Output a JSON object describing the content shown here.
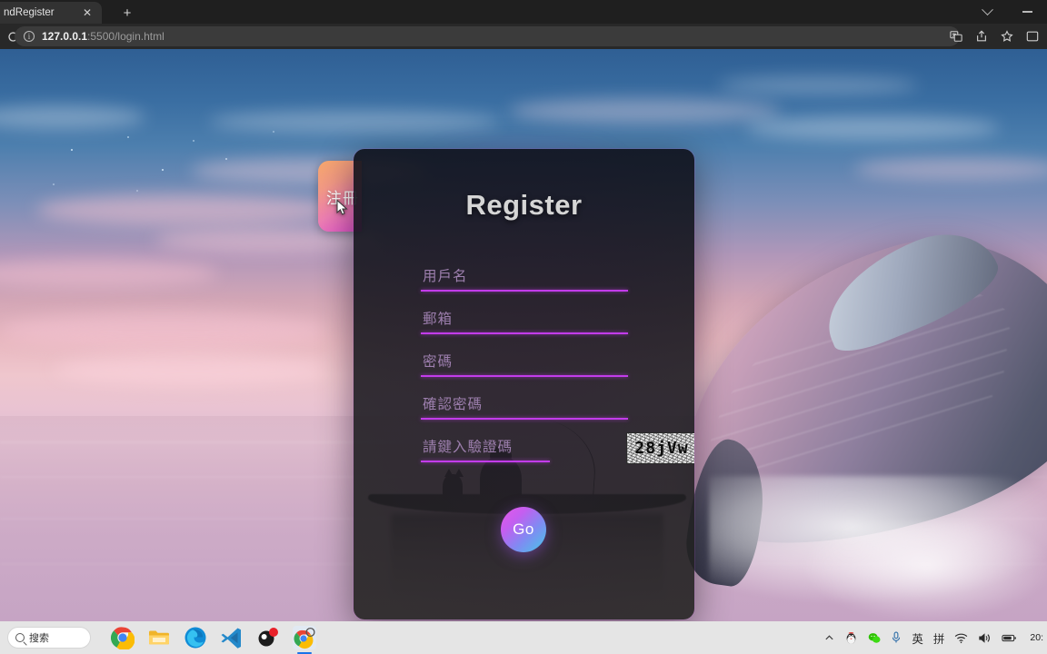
{
  "browser": {
    "tab_title": "ndRegister",
    "tab_close_label": "✕",
    "new_tab_label": "+",
    "url_host": "127.0.0.1",
    "url_path": ":5500/login.html",
    "icons": {
      "reload": "reload-icon",
      "info": "i",
      "translate": "translate-icon",
      "share": "share-icon",
      "bookmark": "star-icon",
      "profile": "profile-icon",
      "chevron_down": "chevron-down-icon",
      "minimize": "minimize-icon"
    }
  },
  "card": {
    "title": "Register",
    "side_tab_label": "注冊",
    "submit_label": "Go",
    "captcha_value": "28jVw",
    "fields": [
      {
        "placeholder": "用戶名",
        "value": "",
        "name": "username"
      },
      {
        "placeholder": "郵箱",
        "value": "",
        "name": "email"
      },
      {
        "placeholder": "密碼",
        "value": "",
        "name": "password"
      },
      {
        "placeholder": "確認密碼",
        "value": "",
        "name": "confirm-password"
      },
      {
        "placeholder": "請鍵入驗證碼",
        "value": "",
        "name": "captcha"
      }
    ],
    "colors": {
      "underline": "#c23cea",
      "placeholder": "#9d7fae",
      "title": "#d5d5d5",
      "tab_gradient_start": "#f7a86b",
      "tab_gradient_end": "#e152cf",
      "go_gradient_start": "#e559e8",
      "go_gradient_end": "#46c8e8"
    }
  },
  "taskbar": {
    "search_placeholder": "搜索",
    "apps": [
      {
        "name": "chrome",
        "label": "Chrome"
      },
      {
        "name": "file-explorer",
        "label": "文件资源管理器"
      },
      {
        "name": "edge",
        "label": "Microsoft Edge"
      },
      {
        "name": "vscode",
        "label": "Visual Studio Code"
      },
      {
        "name": "obs",
        "label": "OBS"
      },
      {
        "name": "chrome-2",
        "label": "Chrome"
      }
    ],
    "tray": {
      "chevron": "^",
      "ime_lang": "英",
      "ime_mode": "拼",
      "clock_time": "20:",
      "clock_date": ""
    }
  }
}
